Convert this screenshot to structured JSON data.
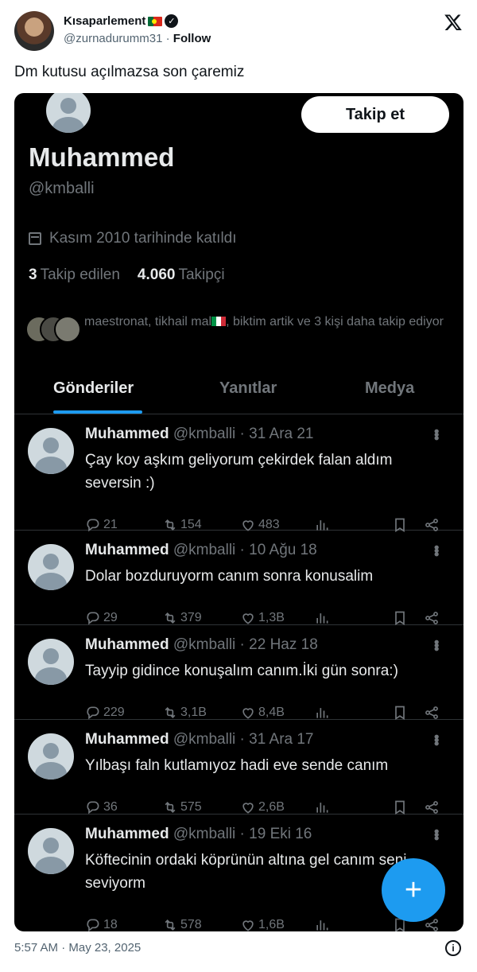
{
  "embed": {
    "author_name": "Kısaparlement",
    "author_handle": "@zurnadurumm31",
    "separator": "·",
    "follow_label": "Follow",
    "verified_mark": "✓",
    "tweet_text": "Dm kutusu açılmazsa son çaremiz",
    "timestamp": "5:57 AM · May 23, 2025",
    "info_glyph": "i"
  },
  "profile": {
    "follow_button": "Takip et",
    "name": "Muhammed",
    "handle": "@kmballi",
    "joined": "Kasım 2010 tarihinde katıldı",
    "following_count": "3",
    "following_label": "Takip edilen",
    "followers_count": "4.060",
    "followers_label": "Takipçi",
    "followed_by_prefix": "maestronat, tikhail mal",
    "followed_by_suffix": ", biktim artik ve 3 kişi daha takip ediyor"
  },
  "tabs": [
    "Gönderiler",
    "Yanıtlar",
    "Medya"
  ],
  "posts": [
    {
      "name": "Muhammed",
      "meta": "@kmballi · 31 Ara 21",
      "text": "Çay koy aşkım geliyorum çekirdek falan aldım seversin :)",
      "replies": "21",
      "reposts": "154",
      "likes": "483"
    },
    {
      "name": "Muhammed",
      "meta": "@kmballi · 10 Ağu 18",
      "text": "Dolar bozduruyorm canım sonra konusalim",
      "replies": "29",
      "reposts": "379",
      "likes": "1,3B"
    },
    {
      "name": "Muhammed",
      "meta": "@kmballi · 22 Haz 18",
      "text": "Tayyip gidince konuşalım canım.İki gün sonra:)",
      "replies": "229",
      "reposts": "3,1B",
      "likes": "8,4B"
    },
    {
      "name": "Muhammed",
      "meta": "@kmballi · 31 Ara 17",
      "text": "Yılbaşı faln kutlamıyoz hadi eve sende canım",
      "replies": "36",
      "reposts": "575",
      "likes": "2,6B"
    },
    {
      "name": "Muhammed",
      "meta": "@kmballi · 19 Eki 16",
      "text": "Köftecinin ordaki köprünün altına gel canım seni seviyorm",
      "replies": "18",
      "reposts": "578",
      "likes": "1,6B"
    }
  ],
  "fab_label": "+",
  "colors": {
    "accent": "#1d9bf0",
    "dark_bg": "#000000",
    "muted": "#71767b"
  }
}
